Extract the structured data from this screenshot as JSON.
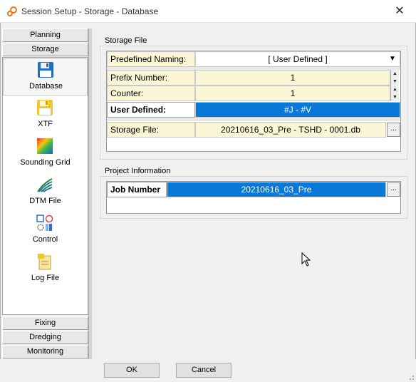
{
  "window": {
    "title": "Session Setup - Storage -  Database",
    "close_glyph": "✕"
  },
  "nav": {
    "headers_top": [
      "Planning",
      "Storage"
    ],
    "items": [
      {
        "label": "Database",
        "icon": "floppy-disk-blue-icon",
        "selected": true
      },
      {
        "label": "XTF",
        "icon": "floppy-disk-yellow-icon",
        "selected": false
      },
      {
        "label": "Sounding Grid",
        "icon": "sounding-grid-icon",
        "selected": false
      },
      {
        "label": "DTM File",
        "icon": "dtm-file-icon",
        "selected": false
      },
      {
        "label": "Control",
        "icon": "control-icon",
        "selected": false
      },
      {
        "label": "Log File",
        "icon": "log-file-icon",
        "selected": false
      }
    ],
    "headers_bottom": [
      "Fixing",
      "Dredging",
      "Monitoring"
    ]
  },
  "storage_file": {
    "group_title": "Storage File",
    "predefined_naming_label": "Predefined Naming:",
    "predefined_naming_value": "[ User Defined ]",
    "prefix_number_label": "Prefix Number:",
    "prefix_number_value": "1",
    "counter_label": "Counter:",
    "counter_value": "1",
    "user_defined_label": "User Defined:",
    "user_defined_value": "#J - #V",
    "storage_file_label": "Storage File:",
    "storage_file_value": "20210616_03_Pre - TSHD - 0001.db",
    "browse_label": "..."
  },
  "project_info": {
    "group_title": "Project Information",
    "job_number_label": "Job Number",
    "job_number_value": "20210616_03_Pre",
    "browse_label": "..."
  },
  "buttons": {
    "ok": "OK",
    "cancel": "Cancel"
  },
  "colors": {
    "selected_blue": "#0a78d7",
    "cell_yellow": "#fbf7d6"
  }
}
